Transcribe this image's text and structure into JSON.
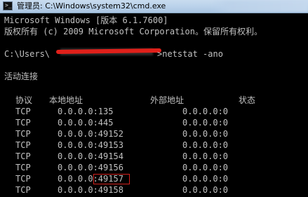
{
  "window": {
    "title": "管理员: C:\\Windows\\system32\\cmd.exe"
  },
  "console": {
    "header_line1": "Microsoft Windows [版本 6.1.7600]",
    "header_line2": "版权所有 (c) 2009 Microsoft Corporation。保留所有权利。",
    "prompt_prefix": "C:\\Users\\",
    "prompt_suffix": ">netstat -ano",
    "section_title": "活动连接",
    "columns": [
      "协议",
      "本地地址",
      "外部地址",
      "状态"
    ],
    "rows": [
      {
        "proto": "TCP",
        "local": "0.0.0.0:135",
        "foreign": "0.0.0.0:0"
      },
      {
        "proto": "TCP",
        "local": "0.0.0.0:445",
        "foreign": "0.0.0.0:0"
      },
      {
        "proto": "TCP",
        "local": "0.0.0.0:49152",
        "foreign": "0.0.0.0:0"
      },
      {
        "proto": "TCP",
        "local": "0.0.0.0:49153",
        "foreign": "0.0.0.0:0"
      },
      {
        "proto": "TCP",
        "local": "0.0.0.0:49154",
        "foreign": "0.0.0.0:0"
      },
      {
        "proto": "TCP",
        "local": "0.0.0.0:49156",
        "foreign": "0.0.0.0:0"
      },
      {
        "proto": "TCP",
        "local": "0.0.0.0:49157",
        "foreign": "0.0.0.0:0",
        "highlighted": true
      },
      {
        "proto": "TCP",
        "local": "0.0.0.0:49158",
        "foreign": "0.0.0.0:0"
      }
    ]
  },
  "colors": {
    "console_background": "#000000",
    "console_text": "#c0c0c0",
    "highlight_box": "#d2201c",
    "redaction": "#e0201a",
    "titlebar": "#b9d1ea"
  },
  "icons": {
    "window_icon": "cmd-icon"
  }
}
